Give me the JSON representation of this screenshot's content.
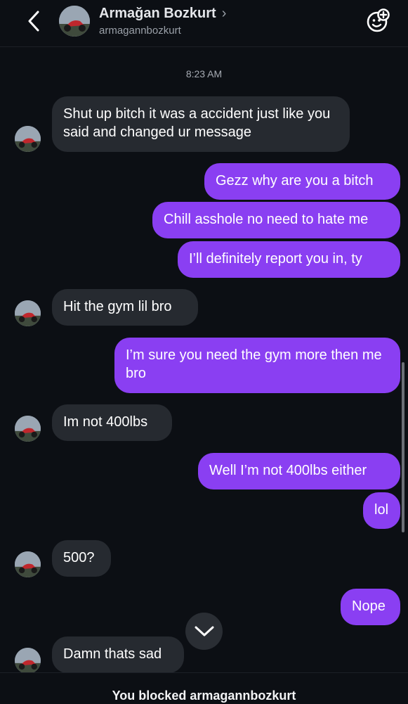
{
  "header": {
    "name": "Armağan Bozkurt",
    "chevron": "›",
    "username": "armagannbozkurt",
    "icons": [
      "back-chevron-icon",
      "avatar",
      "add-effect-icon"
    ]
  },
  "timestamp": "8:23 AM",
  "messages": [
    {
      "side": "in",
      "text": "Shut up bitch it was a accident just like you said and changed ur message"
    },
    {
      "side": "out",
      "text": "Gezz why are you a bitch"
    },
    {
      "side": "out",
      "text": "Chill asshole no need to hate me"
    },
    {
      "side": "out",
      "text": "I’ll definitely report you in, ty"
    },
    {
      "side": "in",
      "text": "Hit the gym lil bro"
    },
    {
      "side": "out",
      "text": "I’m sure you need the gym more then me bro"
    },
    {
      "side": "in",
      "text": "Im not 400lbs"
    },
    {
      "side": "out",
      "text": "Well I’m not 400lbs either"
    },
    {
      "side": "out",
      "text": "lol"
    },
    {
      "side": "in",
      "text": "500?"
    },
    {
      "side": "out",
      "text": "Nope"
    },
    {
      "side": "in",
      "text": "Damn thats sad"
    }
  ],
  "footer": {
    "blocked_text": "You blocked armagannbozkurt"
  },
  "colors": {
    "outgoing": "#8a3ff2",
    "incoming": "#262a30",
    "background": "#0c0f14"
  }
}
